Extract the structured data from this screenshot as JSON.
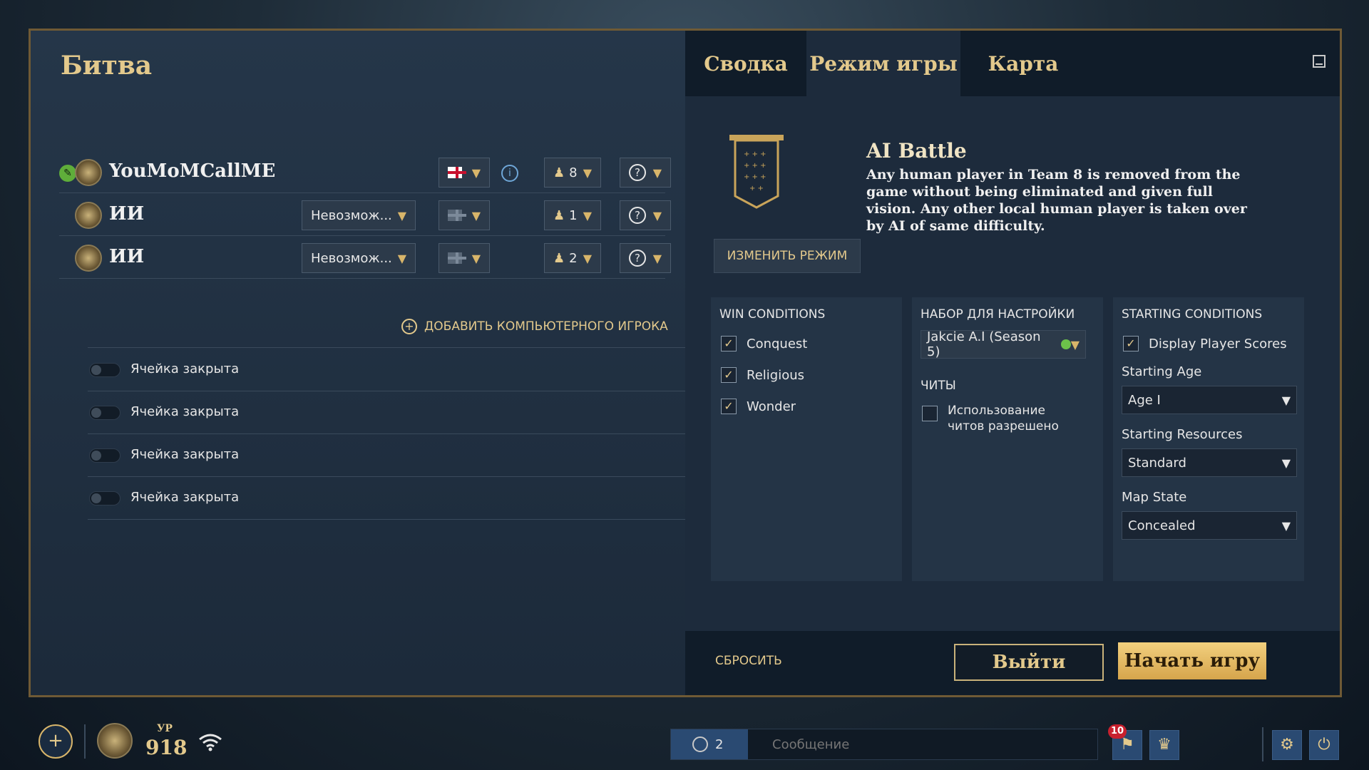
{
  "left": {
    "title": "Битва",
    "players": [
      {
        "name": "YouMoMCallME",
        "difficulty": "",
        "civ_flag": "england",
        "team": "8",
        "color": "?"
      },
      {
        "name": "ИИ",
        "difficulty": "Невозмож...",
        "civ_flag": "random",
        "team": "1",
        "color": "?"
      },
      {
        "name": "ИИ",
        "difficulty": "Невозмож...",
        "civ_flag": "random",
        "team": "2",
        "color": "?"
      }
    ],
    "add_ai_label": "ДОБАВИТЬ КОМПЬЮТЕРНОГО ИГРОКА",
    "closed_slots": [
      "Ячейка закрыта",
      "Ячейка закрыта",
      "Ячейка закрыта",
      "Ячейка закрыта"
    ]
  },
  "tabs": [
    "Сводка",
    "Режим игры",
    "Карта"
  ],
  "mode": {
    "title": "AI Battle",
    "description": "Any human player in Team 8 is removed from the game without being eliminated and given full vision. Any other local human player is taken over by AI of same difficulty.",
    "change_button": "ИЗМЕНИТЬ РЕЖИМ"
  },
  "win_conditions": {
    "heading": "WIN CONDITIONS",
    "items": [
      {
        "label": "Conquest",
        "checked": true
      },
      {
        "label": "Religious",
        "checked": true
      },
      {
        "label": "Wonder",
        "checked": true
      }
    ]
  },
  "tuning": {
    "heading": "НАБОР ДЛЯ НАСТРОЙКИ",
    "selected": "Jakcie A.I (Season 5)",
    "cheats_heading": "ЧИТЫ",
    "cheats_label": "Использование читов разрешено",
    "cheats_checked": false
  },
  "starting": {
    "heading": "STARTING CONDITIONS",
    "display_scores_label": "Display Player Scores",
    "display_scores_checked": true,
    "age_label": "Starting Age",
    "age_value": "Age I",
    "resources_label": "Starting Resources",
    "resources_value": "Standard",
    "map_state_label": "Map State",
    "map_state_value": "Concealed"
  },
  "footer": {
    "reset": "СБРОСИТЬ",
    "exit": "Выйти",
    "start": "Начать игру"
  },
  "bottom_bar": {
    "level_label": "УР",
    "level_value": "918",
    "online_count": "2",
    "chat_placeholder": "Сообщение",
    "notifications": "10"
  },
  "colors": {
    "gold": "#e3c98c",
    "panel_dark": "#101c29",
    "accent_green": "#6cc24a"
  }
}
